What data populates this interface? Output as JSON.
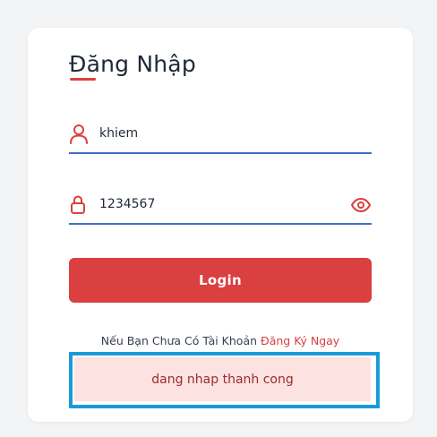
{
  "form": {
    "title": "Đăng Nhập",
    "username": {
      "value": "khiem",
      "icon": "user-icon"
    },
    "password": {
      "value": "1234567",
      "icon": "lock-icon",
      "toggle_icon": "eye-icon"
    },
    "login_label": "Login",
    "register_prompt": "Nếu Bạn Chưa Có Tài Khoản",
    "register_link": "Đăng Ký Ngay"
  },
  "alert": {
    "message": "dang nhap thanh cong"
  },
  "colors": {
    "accent": "#d9403f",
    "input_underline": "#3f6fc6",
    "alert_bg": "#fde2e2",
    "alert_text": "#9b2c2c",
    "highlight_border": "#1a9bd8"
  }
}
